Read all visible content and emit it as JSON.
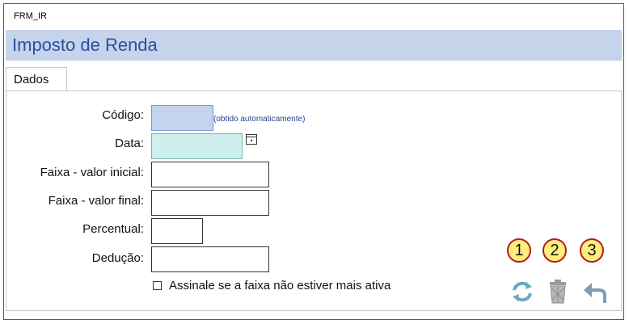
{
  "window": {
    "title": "FRM_IR"
  },
  "header": {
    "title": "Imposto de Renda"
  },
  "tabs": [
    {
      "label": "Dados"
    }
  ],
  "form": {
    "codigo": {
      "label": "Código:",
      "value": "",
      "hint": "(obtido automaticamente)"
    },
    "data": {
      "label": "Data:",
      "value": ""
    },
    "faixa_inicial": {
      "label": "Faixa - valor inicial:",
      "value": ""
    },
    "faixa_final": {
      "label": "Faixa - valor final:",
      "value": ""
    },
    "percentual": {
      "label": "Percentual:",
      "value": ""
    },
    "deducao": {
      "label": "Dedução:",
      "value": ""
    },
    "inativa": {
      "label": "Assinale se a faixa não estiver mais ativa",
      "checked": false
    }
  },
  "toolbar": {
    "badges": [
      "1",
      "2",
      "3"
    ],
    "buttons": [
      {
        "icon": "refresh-icon"
      },
      {
        "icon": "trash-icon"
      },
      {
        "icon": "undo-arrow-icon"
      }
    ]
  },
  "colors": {
    "header_bg": "#c5d4eb",
    "header_text": "#2b4f9e",
    "codigo_bg": "#c3d3f0",
    "data_bg": "#cfeeee",
    "badge_bg": "#ffef7a",
    "badge_border": "#b01c1c",
    "window_border": "#b0303a"
  }
}
